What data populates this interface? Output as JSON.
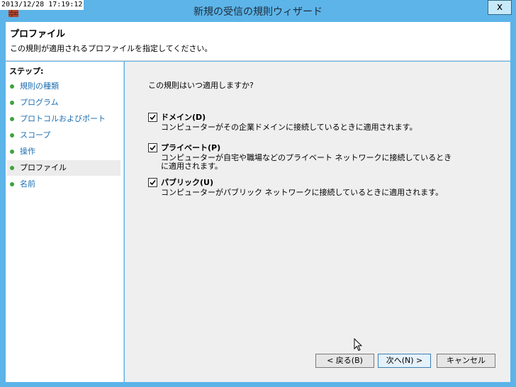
{
  "system": {
    "timestamp": "2013/12/28  17:19:12"
  },
  "window": {
    "title": "新規の受信の規則ウィザード",
    "close_label": "x"
  },
  "header": {
    "title": "プロファイル",
    "description": "この規則が適用されるプロファイルを指定してください。"
  },
  "sidebar": {
    "title": "ステップ:",
    "items": [
      {
        "label": "規則の種類",
        "active": false
      },
      {
        "label": "プログラム",
        "active": false
      },
      {
        "label": "プロトコルおよびポート",
        "active": false
      },
      {
        "label": "スコープ",
        "active": false
      },
      {
        "label": "操作",
        "active": false
      },
      {
        "label": "プロファイル",
        "active": true
      },
      {
        "label": "名前",
        "active": false
      }
    ]
  },
  "main": {
    "question": "この規則はいつ適用しますか?",
    "options": [
      {
        "label": "ドメイン(D)",
        "checked": true,
        "description": "コンピューターがその企業ドメインに接続しているときに適用されます。"
      },
      {
        "label": "プライベート(P)",
        "checked": true,
        "description": "コンピューターが自宅や職場などのプライベート ネットワークに接続しているときに適用されます。"
      },
      {
        "label": "パブリック(U)",
        "checked": true,
        "description": "コンピューターがパブリック ネットワークに接続しているときに適用されます。"
      }
    ]
  },
  "buttons": {
    "back": "< 戻る(B)",
    "next": "次へ(N) >",
    "cancel": "キャンセル"
  }
}
